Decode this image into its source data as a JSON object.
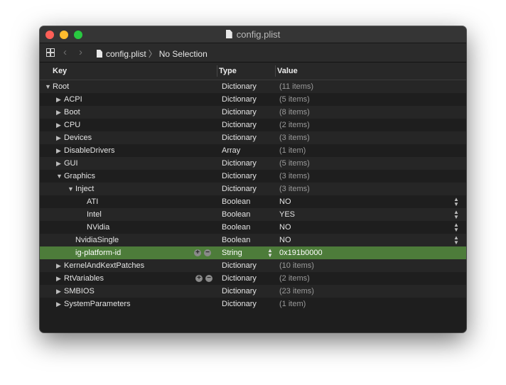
{
  "window": {
    "title": "config.plist",
    "colors": {
      "close": "#ff5f57",
      "minimize": "#febc2e",
      "maximize": "#28c840",
      "selection": "#4d7c3a"
    }
  },
  "navbar": {
    "file": "config.plist",
    "separator": "〉",
    "selection": "No Selection",
    "back_icon": "chevron-left-icon",
    "forward_icon": "chevron-right-icon",
    "grid_icon": "grid-icon"
  },
  "columns": {
    "key": "Key",
    "type": "Type",
    "value": "Value"
  },
  "rows": [
    {
      "key": "Root",
      "type": "Dictionary",
      "value": "(11 items)"
    },
    {
      "key": "ACPI",
      "type": "Dictionary",
      "value": "(5 items)"
    },
    {
      "key": "Boot",
      "type": "Dictionary",
      "value": "(8 items)"
    },
    {
      "key": "CPU",
      "type": "Dictionary",
      "value": "(2 items)"
    },
    {
      "key": "Devices",
      "type": "Dictionary",
      "value": "(3 items)"
    },
    {
      "key": "DisableDrivers",
      "type": "Array",
      "value": "(1 item)"
    },
    {
      "key": "GUI",
      "type": "Dictionary",
      "value": "(5 items)"
    },
    {
      "key": "Graphics",
      "type": "Dictionary",
      "value": "(3 items)"
    },
    {
      "key": "Inject",
      "type": "Dictionary",
      "value": "(3 items)"
    },
    {
      "key": "ATI",
      "type": "Boolean",
      "value": "NO"
    },
    {
      "key": "Intel",
      "type": "Boolean",
      "value": "YES"
    },
    {
      "key": "NVidia",
      "type": "Boolean",
      "value": "NO"
    },
    {
      "key": "NvidiaSingle",
      "type": "Boolean",
      "value": "NO"
    },
    {
      "key": "ig-platform-id",
      "type": "String",
      "value": "0x191b0000"
    },
    {
      "key": "KernelAndKextPatches",
      "type": "Dictionary",
      "value": "(10 items)"
    },
    {
      "key": "RtVariables",
      "type": "Dictionary",
      "value": "(2 items)"
    },
    {
      "key": "SMBIOS",
      "type": "Dictionary",
      "value": "(23 items)"
    },
    {
      "key": "SystemParameters",
      "type": "Dictionary",
      "value": "(1 item)"
    }
  ]
}
